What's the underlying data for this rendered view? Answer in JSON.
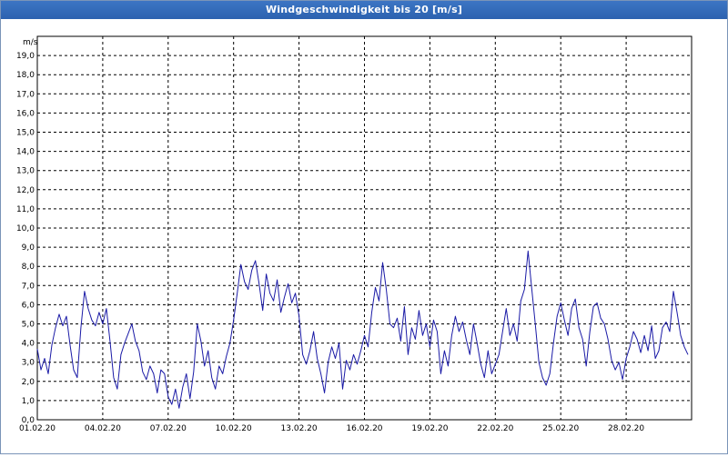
{
  "window": {
    "title": "Windgeschwindigkeit bis 20 [m/s]"
  },
  "chart_data": {
    "type": "line",
    "title": "Windgeschwindigkeit bis 20 [m/s]",
    "y_unit": "m/s",
    "ylim": [
      0,
      20
    ],
    "xlim": [
      "2020-02-01",
      "2020-03-02"
    ],
    "y_ticks": [
      "0,0",
      "1,0",
      "2,0",
      "3,0",
      "4,0",
      "5,0",
      "6,0",
      "7,0",
      "8,0",
      "9,0",
      "10,0",
      "11,0",
      "12,0",
      "13,0",
      "14,0",
      "15,0",
      "16,0",
      "17,0",
      "18,0",
      "19,0"
    ],
    "x_ticks": [
      {
        "label": "01.02.20",
        "date": "2020-02-01"
      },
      {
        "label": "04.02.20",
        "date": "2020-02-04"
      },
      {
        "label": "07.02.20",
        "date": "2020-02-07"
      },
      {
        "label": "10.02.20",
        "date": "2020-02-10"
      },
      {
        "label": "13.02.20",
        "date": "2020-02-13"
      },
      {
        "label": "16.02.20",
        "date": "2020-02-16"
      },
      {
        "label": "19.02.20",
        "date": "2020-02-19"
      },
      {
        "label": "22.02.20",
        "date": "2020-02-22"
      },
      {
        "label": "25.02.20",
        "date": "2020-02-25"
      },
      {
        "label": "28.02.20",
        "date": "2020-02-28"
      }
    ],
    "grid": true,
    "line_color": "#1a1aa6",
    "series": [
      {
        "name": "",
        "points": [
          [
            "2020-02-01 00:00",
            3.7
          ],
          [
            "2020-02-01 04:00",
            2.6
          ],
          [
            "2020-02-01 08:00",
            3.2
          ],
          [
            "2020-02-01 12:00",
            2.4
          ],
          [
            "2020-02-01 16:00",
            3.9
          ],
          [
            "2020-02-01 20:00",
            4.8
          ],
          [
            "2020-02-02 00:00",
            5.5
          ],
          [
            "2020-02-02 04:00",
            4.9
          ],
          [
            "2020-02-02 08:00",
            5.4
          ],
          [
            "2020-02-02 12:00",
            3.9
          ],
          [
            "2020-02-02 16:00",
            2.6
          ],
          [
            "2020-02-02 20:00",
            2.2
          ],
          [
            "2020-02-03 00:00",
            4.8
          ],
          [
            "2020-02-03 04:00",
            6.7
          ],
          [
            "2020-02-03 08:00",
            5.8
          ],
          [
            "2020-02-03 12:00",
            5.2
          ],
          [
            "2020-02-03 16:00",
            4.9
          ],
          [
            "2020-02-03 20:00",
            5.6
          ],
          [
            "2020-02-04 00:00",
            5.0
          ],
          [
            "2020-02-04 04:00",
            5.8
          ],
          [
            "2020-02-04 08:00",
            4.1
          ],
          [
            "2020-02-04 12:00",
            2.2
          ],
          [
            "2020-02-04 16:00",
            1.6
          ],
          [
            "2020-02-04 20:00",
            3.4
          ],
          [
            "2020-02-05 00:00",
            4.0
          ],
          [
            "2020-02-05 04:00",
            4.5
          ],
          [
            "2020-02-05 08:00",
            5.0
          ],
          [
            "2020-02-05 12:00",
            4.1
          ],
          [
            "2020-02-05 16:00",
            3.6
          ],
          [
            "2020-02-05 20:00",
            2.5
          ],
          [
            "2020-02-06 00:00",
            2.1
          ],
          [
            "2020-02-06 04:00",
            2.8
          ],
          [
            "2020-02-06 08:00",
            2.4
          ],
          [
            "2020-02-06 12:00",
            1.4
          ],
          [
            "2020-02-06 16:00",
            2.6
          ],
          [
            "2020-02-06 20:00",
            2.4
          ],
          [
            "2020-02-07 00:00",
            1.2
          ],
          [
            "2020-02-07 04:00",
            0.8
          ],
          [
            "2020-02-07 08:00",
            1.6
          ],
          [
            "2020-02-07 12:00",
            0.6
          ],
          [
            "2020-02-07 16:00",
            1.7
          ],
          [
            "2020-02-07 20:00",
            2.4
          ],
          [
            "2020-02-08 00:00",
            1.1
          ],
          [
            "2020-02-08 04:00",
            2.5
          ],
          [
            "2020-02-08 08:00",
            5.0
          ],
          [
            "2020-02-08 12:00",
            4.1
          ],
          [
            "2020-02-08 16:00",
            2.8
          ],
          [
            "2020-02-08 20:00",
            3.6
          ],
          [
            "2020-02-09 00:00",
            2.2
          ],
          [
            "2020-02-09 04:00",
            1.6
          ],
          [
            "2020-02-09 08:00",
            2.8
          ],
          [
            "2020-02-09 12:00",
            2.4
          ],
          [
            "2020-02-09 16:00",
            3.3
          ],
          [
            "2020-02-09 20:00",
            4.0
          ],
          [
            "2020-02-10 00:00",
            5.2
          ],
          [
            "2020-02-10 04:00",
            6.6
          ],
          [
            "2020-02-10 08:00",
            8.1
          ],
          [
            "2020-02-10 12:00",
            7.2
          ],
          [
            "2020-02-10 16:00",
            6.8
          ],
          [
            "2020-02-10 20:00",
            7.8
          ],
          [
            "2020-02-11 00:00",
            8.3
          ],
          [
            "2020-02-11 04:00",
            7.1
          ],
          [
            "2020-02-11 08:00",
            5.7
          ],
          [
            "2020-02-11 12:00",
            7.6
          ],
          [
            "2020-02-11 16:00",
            6.6
          ],
          [
            "2020-02-11 20:00",
            6.2
          ],
          [
            "2020-02-12 00:00",
            7.3
          ],
          [
            "2020-02-12 04:00",
            5.6
          ],
          [
            "2020-02-12 08:00",
            6.4
          ],
          [
            "2020-02-12 12:00",
            7.1
          ],
          [
            "2020-02-12 16:00",
            6.1
          ],
          [
            "2020-02-12 20:00",
            6.6
          ],
          [
            "2020-02-13 00:00",
            5.4
          ],
          [
            "2020-02-13 04:00",
            3.4
          ],
          [
            "2020-02-13 08:00",
            2.9
          ],
          [
            "2020-02-13 12:00",
            3.6
          ],
          [
            "2020-02-13 16:00",
            4.6
          ],
          [
            "2020-02-13 20:00",
            3.2
          ],
          [
            "2020-02-14 00:00",
            2.4
          ],
          [
            "2020-02-14 04:00",
            1.4
          ],
          [
            "2020-02-14 08:00",
            3.0
          ],
          [
            "2020-02-14 12:00",
            3.8
          ],
          [
            "2020-02-14 16:00",
            3.2
          ],
          [
            "2020-02-14 20:00",
            4.0
          ],
          [
            "2020-02-15 00:00",
            1.6
          ],
          [
            "2020-02-15 04:00",
            3.1
          ],
          [
            "2020-02-15 08:00",
            2.6
          ],
          [
            "2020-02-15 12:00",
            3.4
          ],
          [
            "2020-02-15 16:00",
            2.9
          ],
          [
            "2020-02-15 20:00",
            3.6
          ],
          [
            "2020-02-16 00:00",
            4.4
          ],
          [
            "2020-02-16 04:00",
            3.8
          ],
          [
            "2020-02-16 08:00",
            5.6
          ],
          [
            "2020-02-16 12:00",
            6.9
          ],
          [
            "2020-02-16 16:00",
            6.2
          ],
          [
            "2020-02-16 20:00",
            8.2
          ],
          [
            "2020-02-17 00:00",
            6.8
          ],
          [
            "2020-02-17 04:00",
            5.0
          ],
          [
            "2020-02-17 08:00",
            4.8
          ],
          [
            "2020-02-17 12:00",
            5.3
          ],
          [
            "2020-02-17 16:00",
            4.1
          ],
          [
            "2020-02-17 20:00",
            5.9
          ],
          [
            "2020-02-18 00:00",
            3.4
          ],
          [
            "2020-02-18 04:00",
            4.8
          ],
          [
            "2020-02-18 08:00",
            4.2
          ],
          [
            "2020-02-18 12:00",
            5.7
          ],
          [
            "2020-02-18 16:00",
            4.4
          ],
          [
            "2020-02-18 20:00",
            5.0
          ],
          [
            "2020-02-19 00:00",
            3.8
          ],
          [
            "2020-02-19 04:00",
            5.2
          ],
          [
            "2020-02-19 08:00",
            4.6
          ],
          [
            "2020-02-19 12:00",
            2.4
          ],
          [
            "2020-02-19 16:00",
            3.6
          ],
          [
            "2020-02-19 20:00",
            2.8
          ],
          [
            "2020-02-20 00:00",
            4.4
          ],
          [
            "2020-02-20 04:00",
            5.4
          ],
          [
            "2020-02-20 08:00",
            4.6
          ],
          [
            "2020-02-20 12:00",
            5.1
          ],
          [
            "2020-02-20 16:00",
            4.2
          ],
          [
            "2020-02-20 20:00",
            3.4
          ],
          [
            "2020-02-21 00:00",
            5.0
          ],
          [
            "2020-02-21 04:00",
            4.0
          ],
          [
            "2020-02-21 08:00",
            2.9
          ],
          [
            "2020-02-21 12:00",
            2.2
          ],
          [
            "2020-02-21 16:00",
            3.6
          ],
          [
            "2020-02-21 20:00",
            2.4
          ],
          [
            "2020-02-22 00:00",
            2.9
          ],
          [
            "2020-02-22 04:00",
            3.4
          ],
          [
            "2020-02-22 08:00",
            4.6
          ],
          [
            "2020-02-22 12:00",
            5.8
          ],
          [
            "2020-02-22 16:00",
            4.4
          ],
          [
            "2020-02-22 20:00",
            5.0
          ],
          [
            "2020-02-23 00:00",
            4.1
          ],
          [
            "2020-02-23 04:00",
            6.2
          ],
          [
            "2020-02-23 08:00",
            6.8
          ],
          [
            "2020-02-23 12:00",
            8.8
          ],
          [
            "2020-02-23 16:00",
            6.9
          ],
          [
            "2020-02-23 20:00",
            5.0
          ],
          [
            "2020-02-24 00:00",
            3.0
          ],
          [
            "2020-02-24 04:00",
            2.2
          ],
          [
            "2020-02-24 08:00",
            1.8
          ],
          [
            "2020-02-24 12:00",
            2.4
          ],
          [
            "2020-02-24 16:00",
            4.0
          ],
          [
            "2020-02-24 20:00",
            5.4
          ],
          [
            "2020-02-25 00:00",
            6.1
          ],
          [
            "2020-02-25 04:00",
            5.2
          ],
          [
            "2020-02-25 08:00",
            4.4
          ],
          [
            "2020-02-25 12:00",
            5.8
          ],
          [
            "2020-02-25 16:00",
            6.3
          ],
          [
            "2020-02-25 20:00",
            4.8
          ],
          [
            "2020-02-26 00:00",
            4.2
          ],
          [
            "2020-02-26 04:00",
            2.8
          ],
          [
            "2020-02-26 08:00",
            4.6
          ],
          [
            "2020-02-26 12:00",
            5.9
          ],
          [
            "2020-02-26 16:00",
            6.1
          ],
          [
            "2020-02-26 20:00",
            5.3
          ],
          [
            "2020-02-27 00:00",
            5.0
          ],
          [
            "2020-02-27 04:00",
            4.2
          ],
          [
            "2020-02-27 08:00",
            3.1
          ],
          [
            "2020-02-27 12:00",
            2.6
          ],
          [
            "2020-02-27 16:00",
            3.0
          ],
          [
            "2020-02-27 20:00",
            2.1
          ],
          [
            "2020-02-28 00:00",
            3.2
          ],
          [
            "2020-02-28 04:00",
            3.8
          ],
          [
            "2020-02-28 08:00",
            4.6
          ],
          [
            "2020-02-28 12:00",
            4.2
          ],
          [
            "2020-02-28 16:00",
            3.5
          ],
          [
            "2020-02-28 20:00",
            4.4
          ],
          [
            "2020-02-29 00:00",
            3.6
          ],
          [
            "2020-02-29 04:00",
            4.9
          ],
          [
            "2020-02-29 08:00",
            3.2
          ],
          [
            "2020-02-29 12:00",
            3.6
          ],
          [
            "2020-02-29 16:00",
            4.8
          ],
          [
            "2020-02-29 20:00",
            5.1
          ],
          [
            "2020-03-01 00:00",
            4.6
          ],
          [
            "2020-03-01 04:00",
            6.7
          ],
          [
            "2020-03-01 08:00",
            5.6
          ],
          [
            "2020-03-01 12:00",
            4.4
          ],
          [
            "2020-03-01 16:00",
            3.8
          ],
          [
            "2020-03-01 20:00",
            3.4
          ]
        ]
      }
    ]
  }
}
